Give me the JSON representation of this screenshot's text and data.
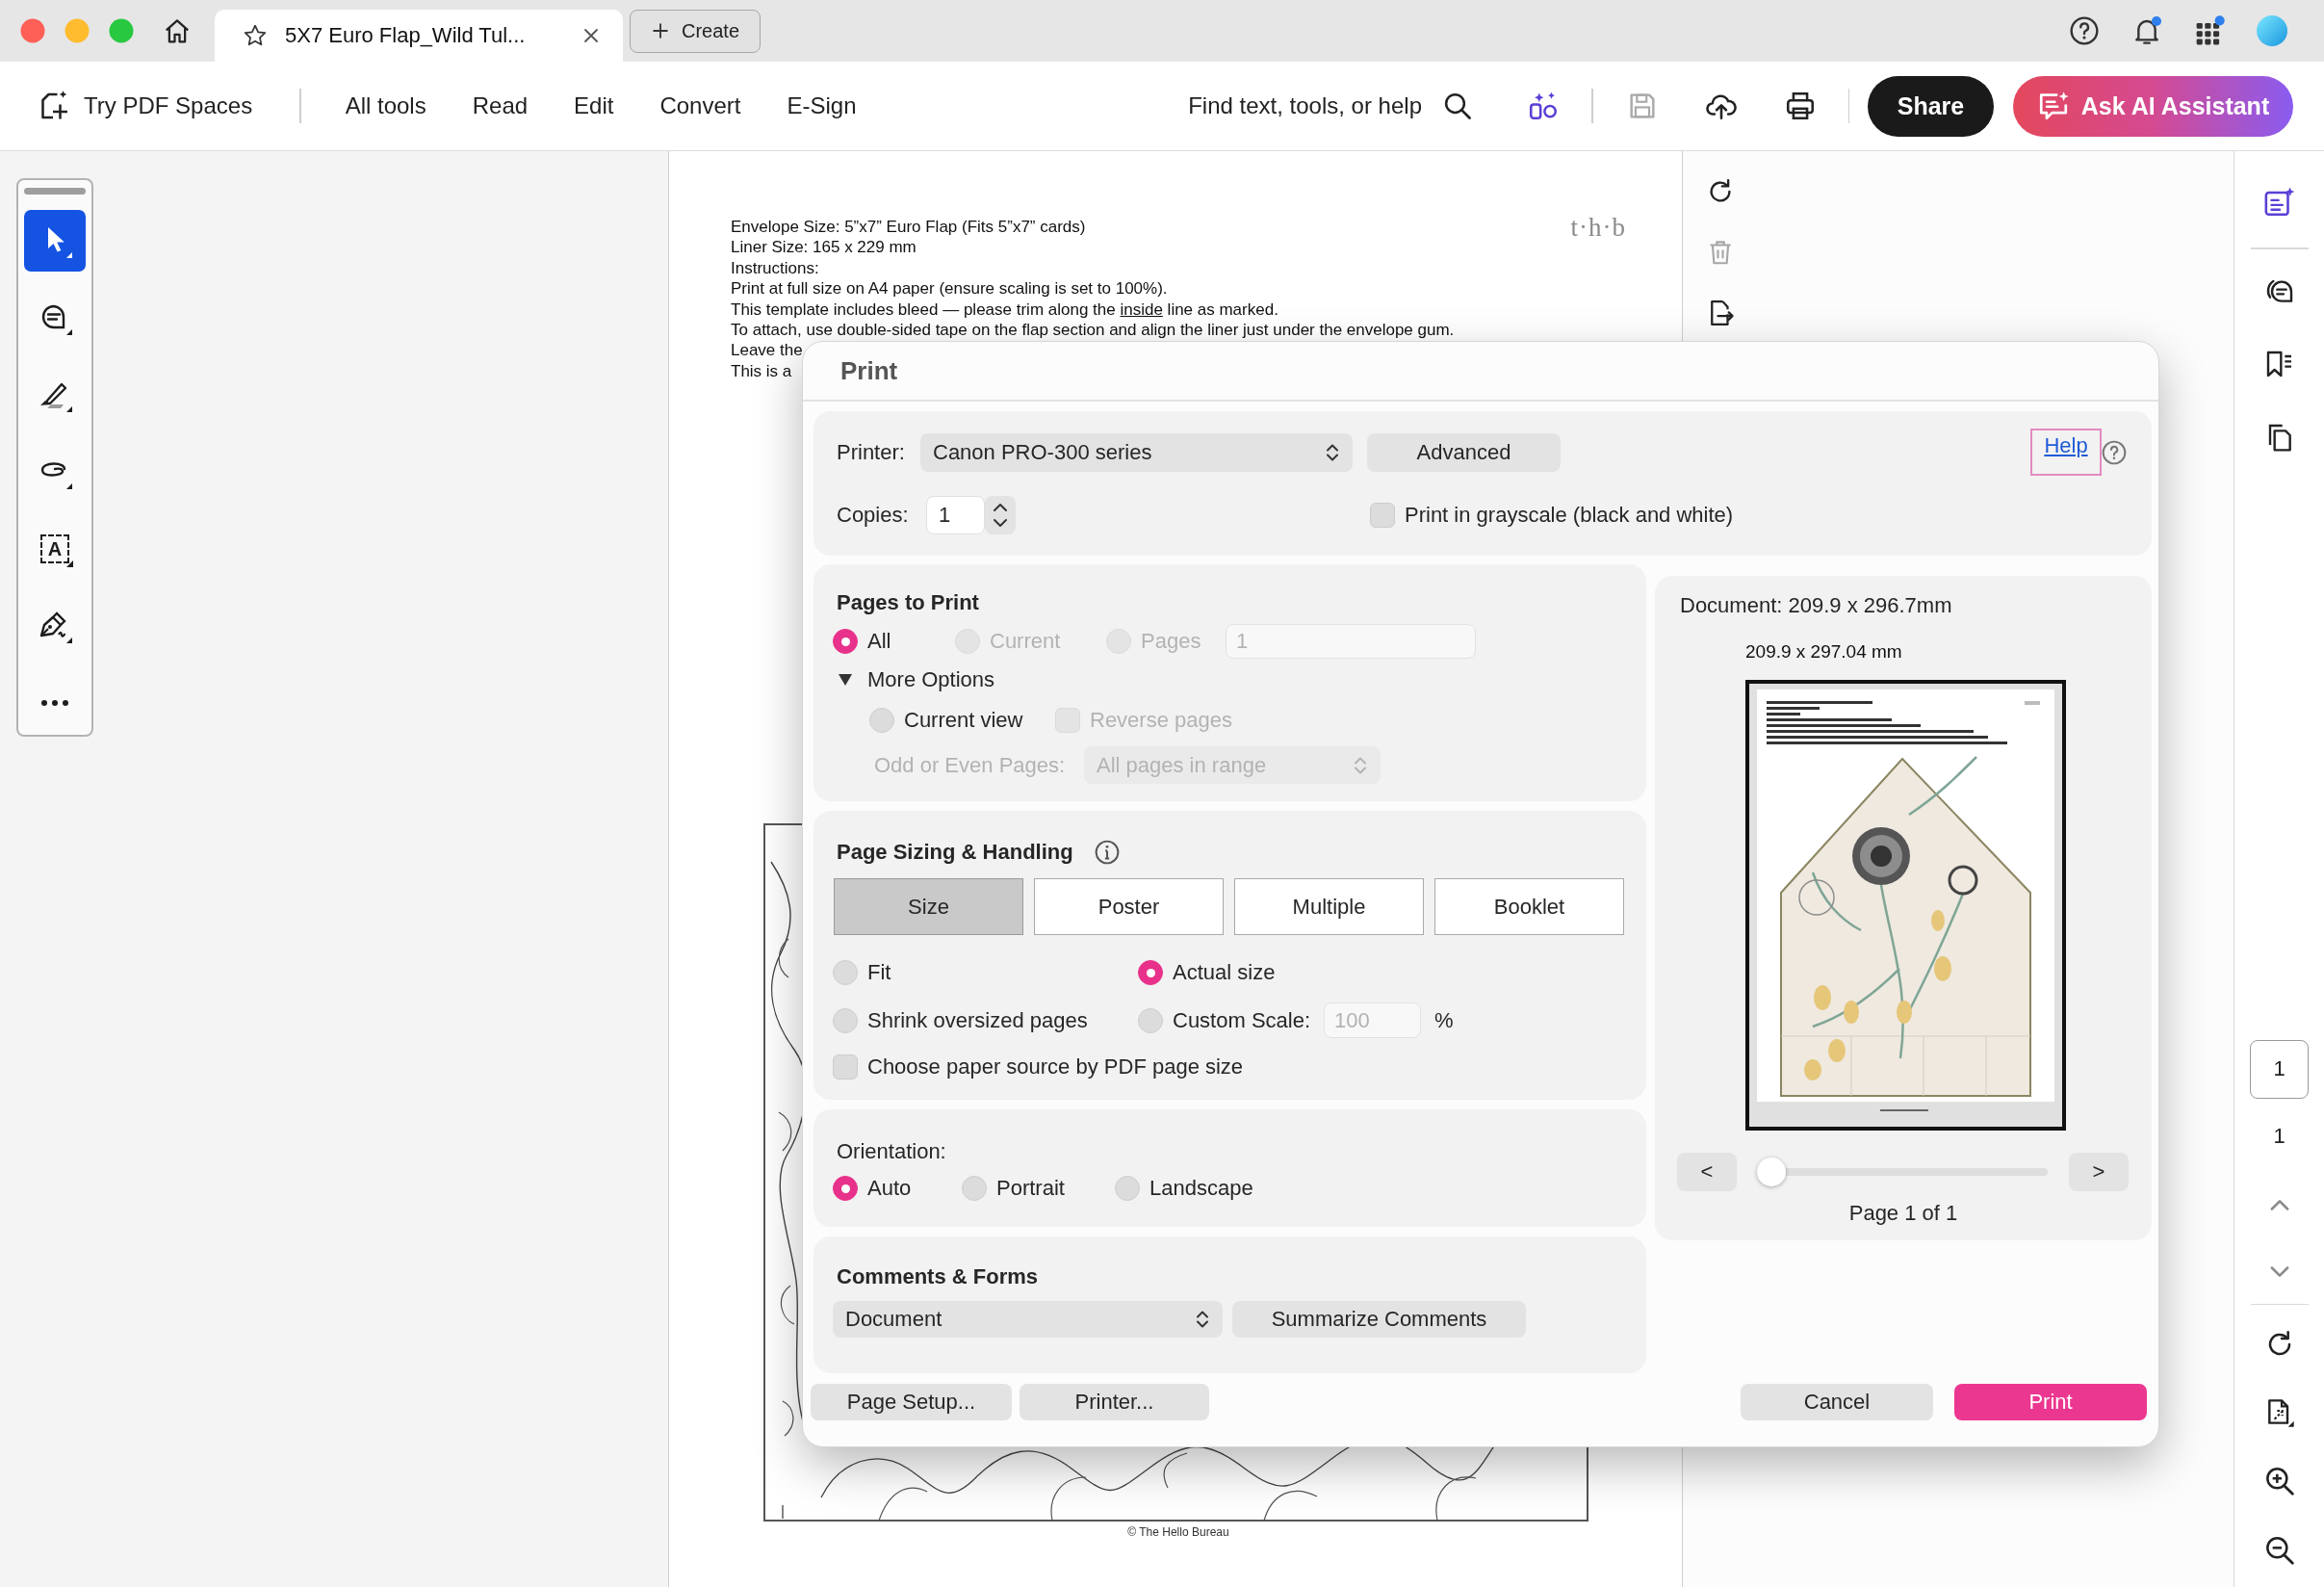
{
  "tab_bar": {
    "tabs": [
      {
        "title": "5X7 Euro Flap_Wild Tul...",
        "selected": true
      }
    ],
    "create_button": "Create"
  },
  "toolbar": {
    "spaces_button": "Try PDF Spaces",
    "menu": [
      "All tools",
      "Read",
      "Edit",
      "Convert",
      "E-Sign"
    ],
    "search_button": "Find text, tools, or help",
    "actions": [
      {
        "kind": "ai-tools",
        "disabled": false
      },
      {
        "kind": "save",
        "disabled": true
      },
      {
        "kind": "upload",
        "disabled": false
      },
      {
        "kind": "print",
        "disabled": false
      }
    ],
    "share_button": "Share",
    "ai_assistant_button": "Ask AI Assistant"
  },
  "tool_rail": {
    "tools": [
      {
        "kind": "select",
        "selected": true
      },
      {
        "kind": "comment",
        "selected": false
      },
      {
        "kind": "highlight",
        "selected": false
      },
      {
        "kind": "draw",
        "selected": false
      },
      {
        "kind": "add-text",
        "glyph": "A",
        "selected": false
      },
      {
        "kind": "sign",
        "selected": false
      },
      {
        "kind": "more",
        "selected": false
      }
    ]
  },
  "document": {
    "lines": [
      {
        "parts": [
          {
            "text": "Envelope Size: 5”x7” Euro Flap (Fits 5”x7” cards)",
            "underline": false
          }
        ]
      },
      {
        "parts": [
          {
            "text": "Liner Size: 165 x 229 mm",
            "underline": false
          }
        ]
      },
      {
        "parts": [
          {
            "text": "Instructions:",
            "underline": false
          }
        ]
      },
      {
        "parts": [
          {
            "text": "Print at full size on A4 paper (ensure scaling is set to 100%).",
            "underline": false
          }
        ]
      },
      {
        "parts": [
          {
            "text": "This template includes bleed — please trim along the ",
            "underline": false
          },
          {
            "text": "inside",
            "underline": true
          },
          {
            "text": " line as marked.",
            "underline": false
          }
        ]
      },
      {
        "parts": [
          {
            "text": "To attach, use double-sided tape on the flap section and align the liner just under the envelope gum.",
            "underline": false
          }
        ]
      },
      {
        "parts": [
          {
            "text": "Leave the",
            "underline": false
          }
        ]
      },
      {
        "parts": [
          {
            "text": "This is a",
            "underline": false
          }
        ]
      }
    ],
    "logo": "t·h·b",
    "footer": "© The Hello Bureau"
  },
  "page_tools": [
    {
      "kind": "rotate",
      "disabled": false
    },
    {
      "kind": "delete",
      "disabled": true
    },
    {
      "kind": "extract",
      "disabled": false
    }
  ],
  "right_sidebar": {
    "page_field": "1",
    "page_count": "1"
  },
  "print_dialog": {
    "title": "Print",
    "printer": {
      "label": "Printer:",
      "value": "Canon PRO-300 series"
    },
    "advanced_button": "Advanced",
    "help_link": {
      "label": "Help",
      "focused": true
    },
    "copies": {
      "label": "Copies:",
      "value": "1"
    },
    "grayscale": {
      "label": "Print in grayscale (black and white)",
      "checked": false
    },
    "pages_to_print": {
      "heading": "Pages to Print",
      "options": [
        {
          "label": "All",
          "selected": true,
          "disabled": false
        },
        {
          "label": "Current",
          "selected": false,
          "disabled": true
        },
        {
          "label": "Pages",
          "selected": false,
          "disabled": true
        }
      ],
      "pages_field": {
        "value": "1",
        "disabled": true
      },
      "more_options": {
        "label": "More Options",
        "expanded": true
      },
      "current_view": {
        "label": "Current view",
        "selected": false,
        "disabled": false
      },
      "reverse_pages": {
        "label": "Reverse pages",
        "checked": false,
        "disabled": true
      },
      "odd_even": {
        "label": "Odd or Even Pages:",
        "value": "All pages in range",
        "disabled": true
      }
    },
    "page_sizing": {
      "heading": "Page Sizing & Handling",
      "modes": [
        {
          "label": "Size",
          "selected": true
        },
        {
          "label": "Poster",
          "selected": false
        },
        {
          "label": "Multiple",
          "selected": false
        },
        {
          "label": "Booklet",
          "selected": false
        }
      ],
      "options": [
        {
          "label": "Fit",
          "selected": false
        },
        {
          "label": "Actual size",
          "selected": true
        },
        {
          "label": "Shrink oversized pages",
          "selected": false
        },
        {
          "label": "Custom Scale:",
          "selected": false
        }
      ],
      "scale_field": {
        "value": "100",
        "disabled": true
      },
      "percent": "%",
      "paper_source": {
        "label": "Choose paper source by PDF page size",
        "checked": false
      }
    },
    "orientation": {
      "label": "Orientation:",
      "options": [
        {
          "label": "Auto",
          "selected": true
        },
        {
          "label": "Portrait",
          "selected": false
        },
        {
          "label": "Landscape",
          "selected": false
        }
      ]
    },
    "comments_forms": {
      "heading": "Comments & Forms",
      "value": "Document",
      "summarize_button": "Summarize Comments"
    },
    "preview": {
      "document_size": "Document: 209.9 x 296.7mm",
      "paper_size": "209.9 x 297.04 mm",
      "prev_button": "<",
      "next_button": ">",
      "slider": {
        "level": 0
      },
      "page_label": "Page 1 of 1"
    },
    "footer_buttons": {
      "page_setup": "Page Setup...",
      "printer": "Printer...",
      "cancel": "Cancel",
      "print": "Print"
    }
  }
}
